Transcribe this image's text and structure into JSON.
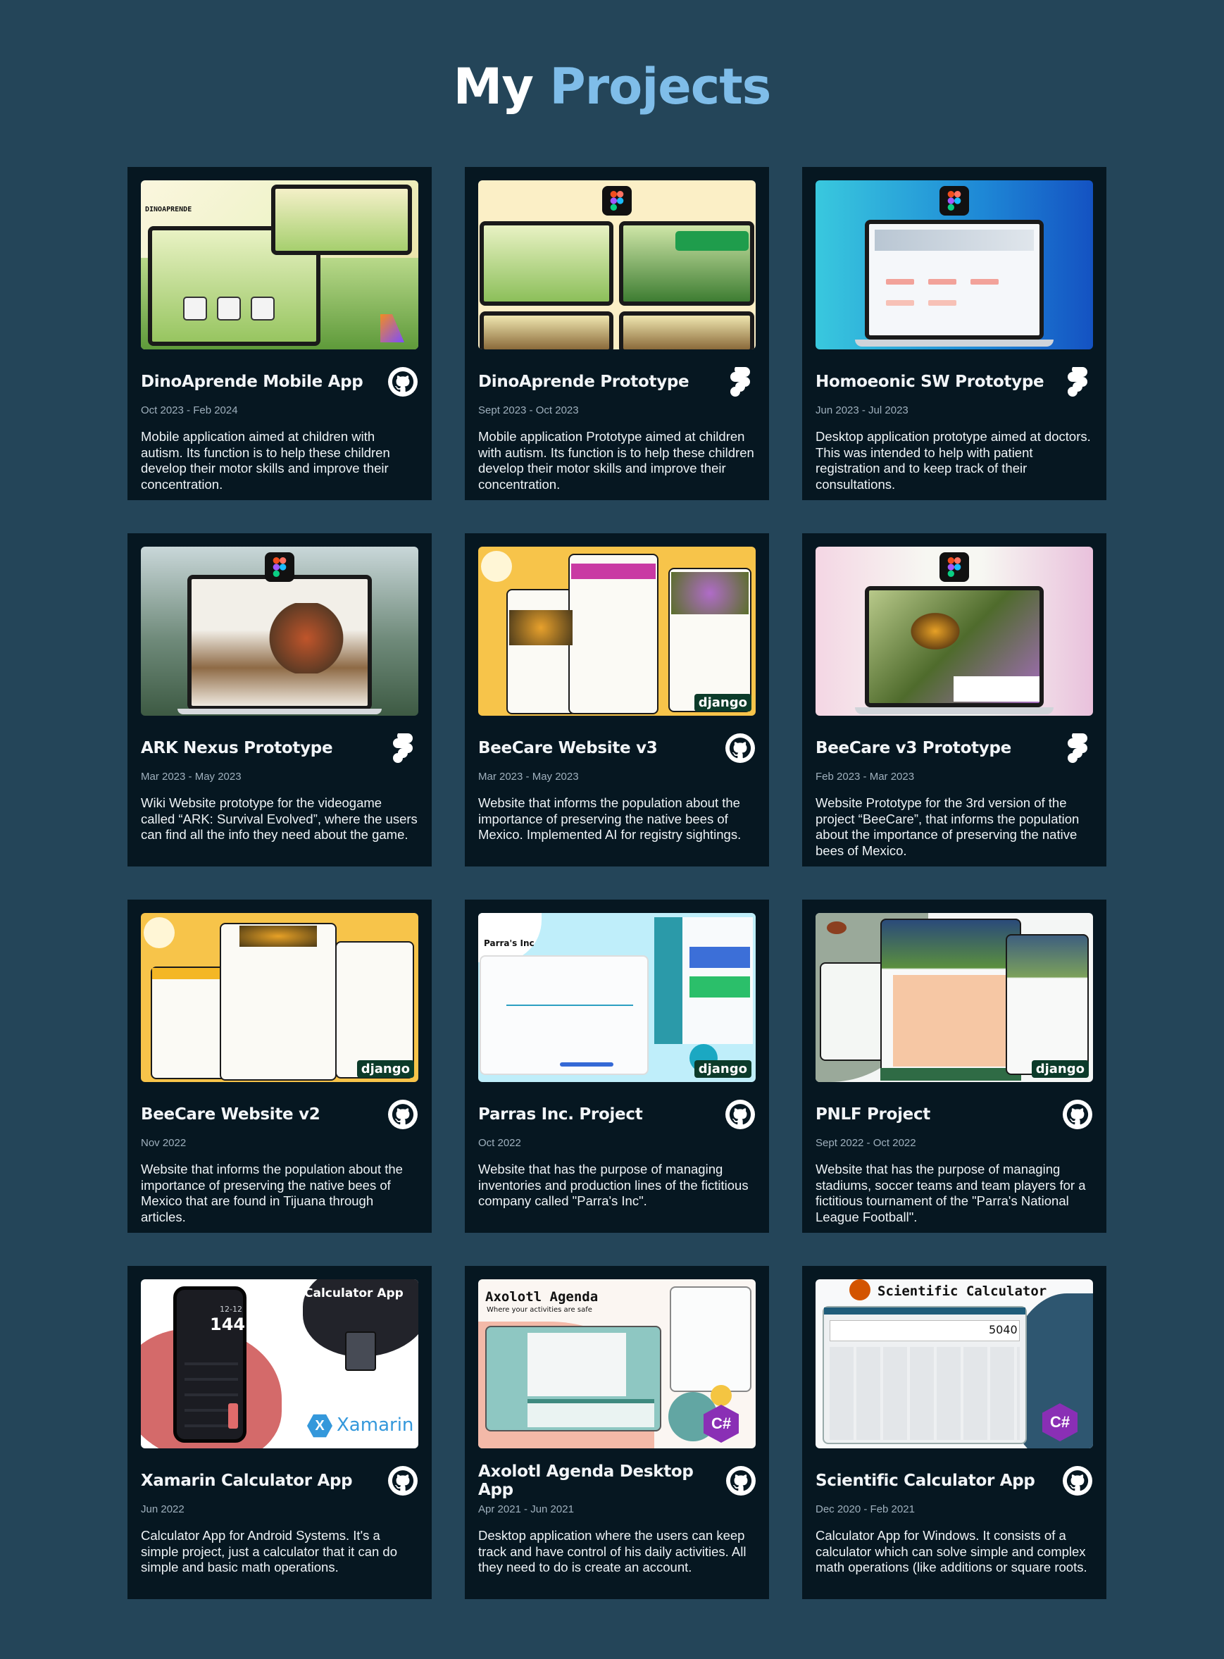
{
  "header": {
    "title_prefix": "My",
    "title_accent": "Projects"
  },
  "colors": {
    "background": "#244559",
    "card": "#061721",
    "accent": "#7fbde9"
  },
  "projects": [
    {
      "title": "DinoAprende Mobile App",
      "date": "Oct 2023 - Feb 2024",
      "icon": "github-icon",
      "description": "Mobile application aimed at children with autism. Its function is to help these children develop their motor skills and improve their concentration.",
      "thumb_text": "DINOAPRENDE"
    },
    {
      "title": "DinoAprende Prototype",
      "date": "Sept 2023 - Oct 2023",
      "icon": "figma-icon",
      "description": "Mobile application Prototype aimed at children with autism. Its function is to help these children develop their motor skills and improve their concentration."
    },
    {
      "title": "Homoeonic SW Prototype",
      "date": "Jun 2023 - Jul 2023",
      "icon": "figma-icon",
      "description": "Desktop application prototype aimed at doctors. This was intended to help with patient registration and to keep track of their consultations."
    },
    {
      "title": "ARK Nexus Prototype",
      "date": "Mar 2023 - May 2023",
      "icon": "figma-icon",
      "description": "Wiki Website prototype for the videogame called “ARK: Survival Evolved”, where the users can find all the info they need about the game."
    },
    {
      "title": "BeeCare Website v3",
      "date": "Mar 2023 - May 2023",
      "icon": "github-icon",
      "description": "Website that informs the population about the importance of preserving the native bees of Mexico. Implemented AI for registry sightings.",
      "badge": "django"
    },
    {
      "title": "BeeCare v3 Prototype",
      "date": "Feb 2023 - Mar 2023",
      "icon": "figma-icon",
      "description": "Website Prototype for the 3rd version of the project “BeeCare”, that informs the population about the importance of preserving the native bees of Mexico."
    },
    {
      "title": "BeeCare Website v2",
      "date": "Nov 2022",
      "icon": "github-icon",
      "description": "Website that informs the population about the importance of preserving the native bees of Mexico that are found in Tijuana through articles.",
      "badge": "django"
    },
    {
      "title": "Parras Inc. Project",
      "date": "Oct 2022",
      "icon": "github-icon",
      "description": "Website that has the purpose of managing inventories and production lines of the fictitious company called \"Parra's Inc\".",
      "badge": "django",
      "thumb_text": "Parra's Inc"
    },
    {
      "title": "PNLF Project",
      "date": "Sept 2022 - Oct 2022",
      "icon": "github-icon",
      "description": "Website that has the purpose of managing stadiums, soccer teams and team players for a fictitious tournament of the \"Parra's National League Football\".",
      "badge": "django"
    },
    {
      "title": "Xamarin Calculator App",
      "date": "Jun 2022",
      "icon": "github-icon",
      "description": "Calculator App for Android Systems. It's a simple project, just a calculator that it can do simple and basic math operations.",
      "thumb_text": "Calculator App",
      "thumb_brand": "Xamarin",
      "thumb_number": "144",
      "thumb_sub": "12-12"
    },
    {
      "title": "Axolotl Agenda Desktop App",
      "date": "Apr 2021 - Jun 2021",
      "icon": "github-icon",
      "description": "Desktop application where the users can keep track and have control of his daily activities. All they need to do is create an account.",
      "thumb_text": "Axolotl Agenda",
      "thumb_sub": "Where your activities are safe"
    },
    {
      "title": "Scientific Calculator App",
      "date": "Dec 2020 - Feb 2021",
      "icon": "github-icon",
      "description": "Calculator App for Windows. It consists of a calculator which can solve simple and complex math operations (like additions or square roots.",
      "thumb_text": "Scientific Calculator",
      "thumb_number": "5040"
    }
  ]
}
